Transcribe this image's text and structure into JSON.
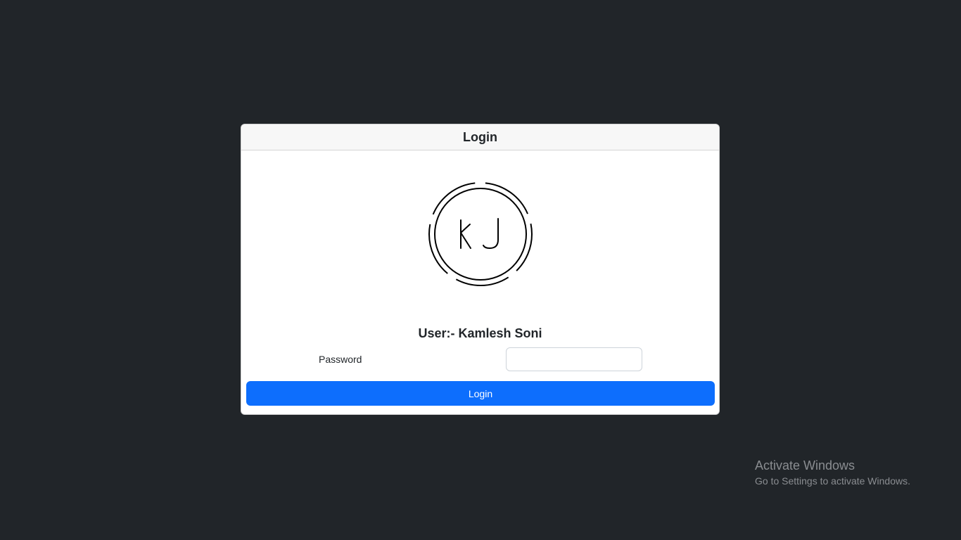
{
  "card": {
    "header_title": "Login",
    "logo_name": "kj-monogram-logo",
    "user_text": "User:- Kamlesh Soni",
    "password_label": "Password",
    "password_value": "",
    "login_button": "Login"
  },
  "watermark": {
    "title": "Activate Windows",
    "subtitle": "Go to Settings to activate Windows."
  },
  "colors": {
    "background": "#212529",
    "primary": "#0d6efd",
    "card": "#ffffff"
  }
}
